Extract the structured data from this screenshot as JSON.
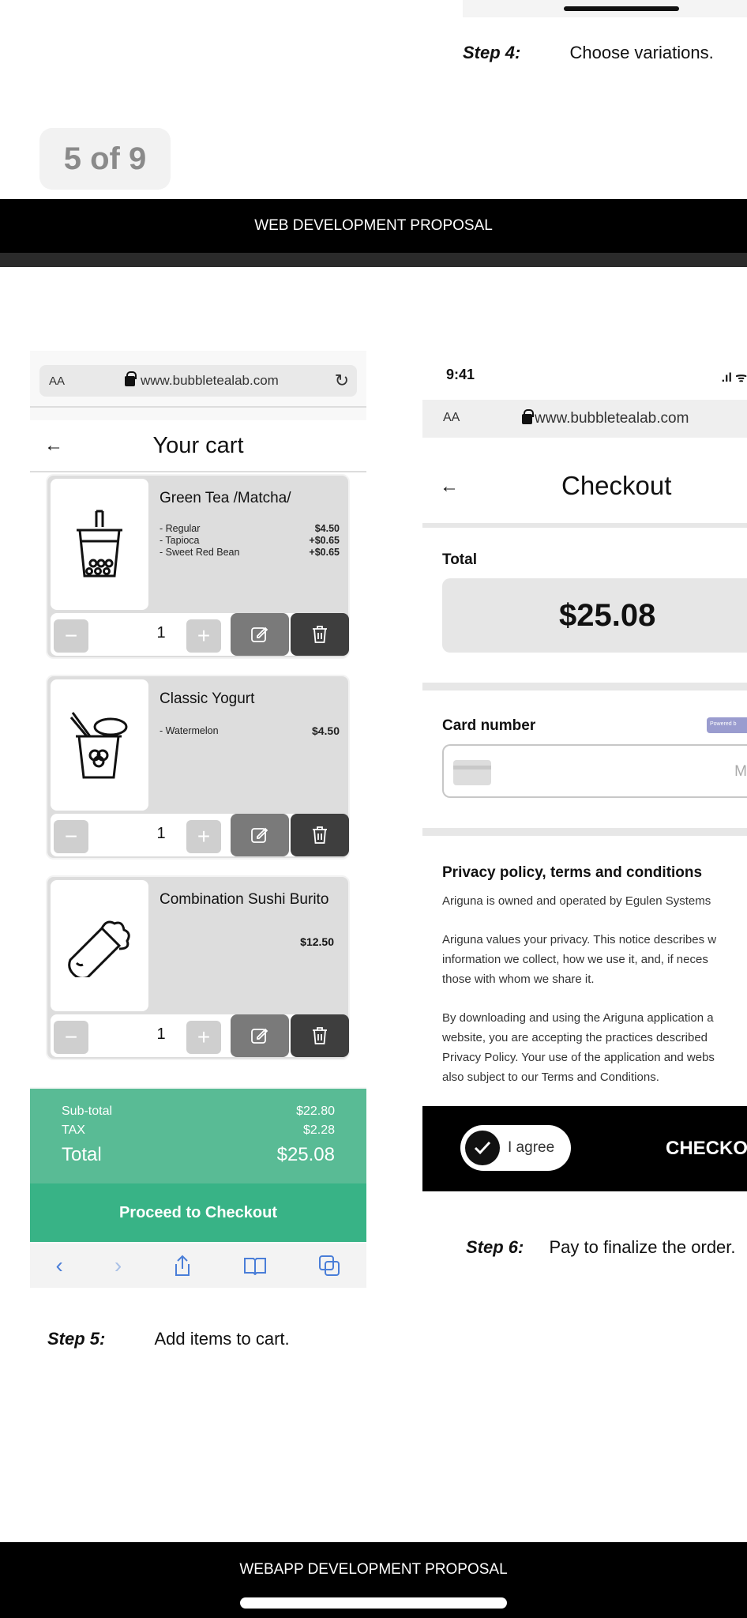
{
  "top": {
    "step4_label": "Step 4:",
    "step4_text": "Choose variations.",
    "page_counter": "5 of 9",
    "banner": "WEB DEVELOPMENT PROPOSAL"
  },
  "cart_screen": {
    "url_aa": "AA",
    "url": "www.bubbletealab.com",
    "back": "←",
    "title": "Your cart",
    "items": [
      {
        "name": "Green Tea /Matcha/",
        "icon": "bubble-tea-icon",
        "options": [
          {
            "label": "- Regular",
            "price": "$4.50"
          },
          {
            "label": "- Tapioca",
            "price": "+$0.65"
          },
          {
            "label": "- Sweet Red Bean",
            "price": "+$0.65"
          }
        ],
        "qty": "1"
      },
      {
        "name": "Classic Yogurt",
        "icon": "yogurt-cup-icon",
        "options": [
          {
            "label": "- Watermelon",
            "price": "$4.50"
          }
        ],
        "qty": "1"
      },
      {
        "name": "Combination Sushi Burito",
        "icon": "burrito-icon",
        "price": "$12.50",
        "qty": "1"
      }
    ],
    "minus": "−",
    "plus": "+",
    "subtotal_label": "Sub-total",
    "subtotal_value": "$22.80",
    "tax_label": "TAX",
    "tax_value": "$2.28",
    "total_label": "Total",
    "total_value": "$25.08",
    "proceed": "Proceed to Checkout",
    "accent": "#38b386",
    "summary_color": "#59bb95"
  },
  "step5_label": "Step 5:",
  "step5_text": "Add items to cart.",
  "checkout_screen": {
    "time": "9:41",
    "url_aa": "AA",
    "url": "www.bubbletealab.com",
    "back": "←",
    "title": "Checkout",
    "total_label": "Total",
    "total_value": "$25.08",
    "card_label": "Card number",
    "powered": "Powered b",
    "card_m": "M",
    "privacy_title": "Privacy policy, terms and conditions",
    "privacy_p1": "Ariguna is owned and operated by Egulen Systems",
    "privacy_p2_l1": "Ariguna values your privacy. This notice describes w",
    "privacy_p2_l2": "information we collect, how we use it, and, if neces",
    "privacy_p2_l3": "those with whom we share it.",
    "privacy_p3_l1": "By downloading and using the Ariguna application a",
    "privacy_p3_l2": "website, you are accepting the practices described",
    "privacy_p3_l3": "Privacy Policy. Your use of the application and webs",
    "privacy_p3_l4": "also subject to our Terms and Conditions.",
    "agree": "I agree",
    "checkout_btn": "CHECKO"
  },
  "step6_label": "Step 6:",
  "step6_text": "Pay to finalize the order.",
  "bottom_banner": "WEBAPP DEVELOPMENT PROPOSAL"
}
